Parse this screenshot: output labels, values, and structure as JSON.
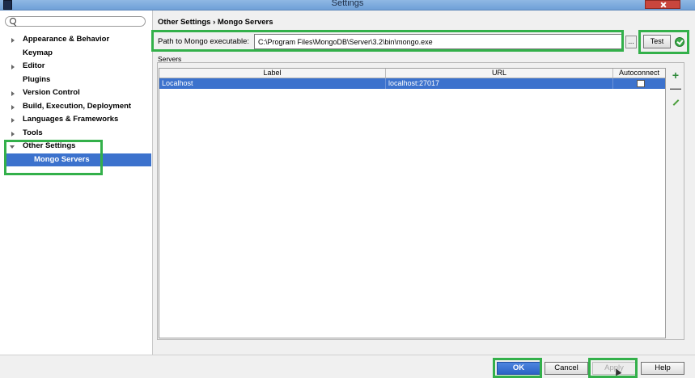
{
  "window": {
    "title": "Settings"
  },
  "search": {
    "placeholder": ""
  },
  "tree": [
    {
      "label": "Appearance & Behavior"
    },
    {
      "label": "Keymap"
    },
    {
      "label": "Editor"
    },
    {
      "label": "Plugins"
    },
    {
      "label": "Version Control"
    },
    {
      "label": "Build, Execution, Deployment"
    },
    {
      "label": "Languages & Frameworks"
    },
    {
      "label": "Tools"
    },
    {
      "label": "Other Settings"
    },
    {
      "label": "Mongo Servers"
    }
  ],
  "main": {
    "breadcrumb": "Other Settings › Mongo Servers",
    "path_label": "Path to Mongo executable:",
    "path_value": "C:\\Program Files\\MongoDB\\Server\\3.2\\bin\\mongo.exe",
    "browse_label": "...",
    "test_label": "Test",
    "servers_label": "Servers",
    "columns": [
      "Label",
      "URL",
      "Autoconnect"
    ],
    "rows": [
      {
        "label": "Localhost",
        "url": "localhost:27017",
        "autoconnect": false
      }
    ]
  },
  "icons": {
    "add": "+",
    "remove": "—"
  },
  "buttons": {
    "ok": "OK",
    "cancel": "Cancel",
    "apply": "Apply",
    "help": "Help"
  },
  "colors": {
    "selection": "#3c72cd",
    "highlight": "#33b04a",
    "titlebar": "#8fb8e4"
  }
}
